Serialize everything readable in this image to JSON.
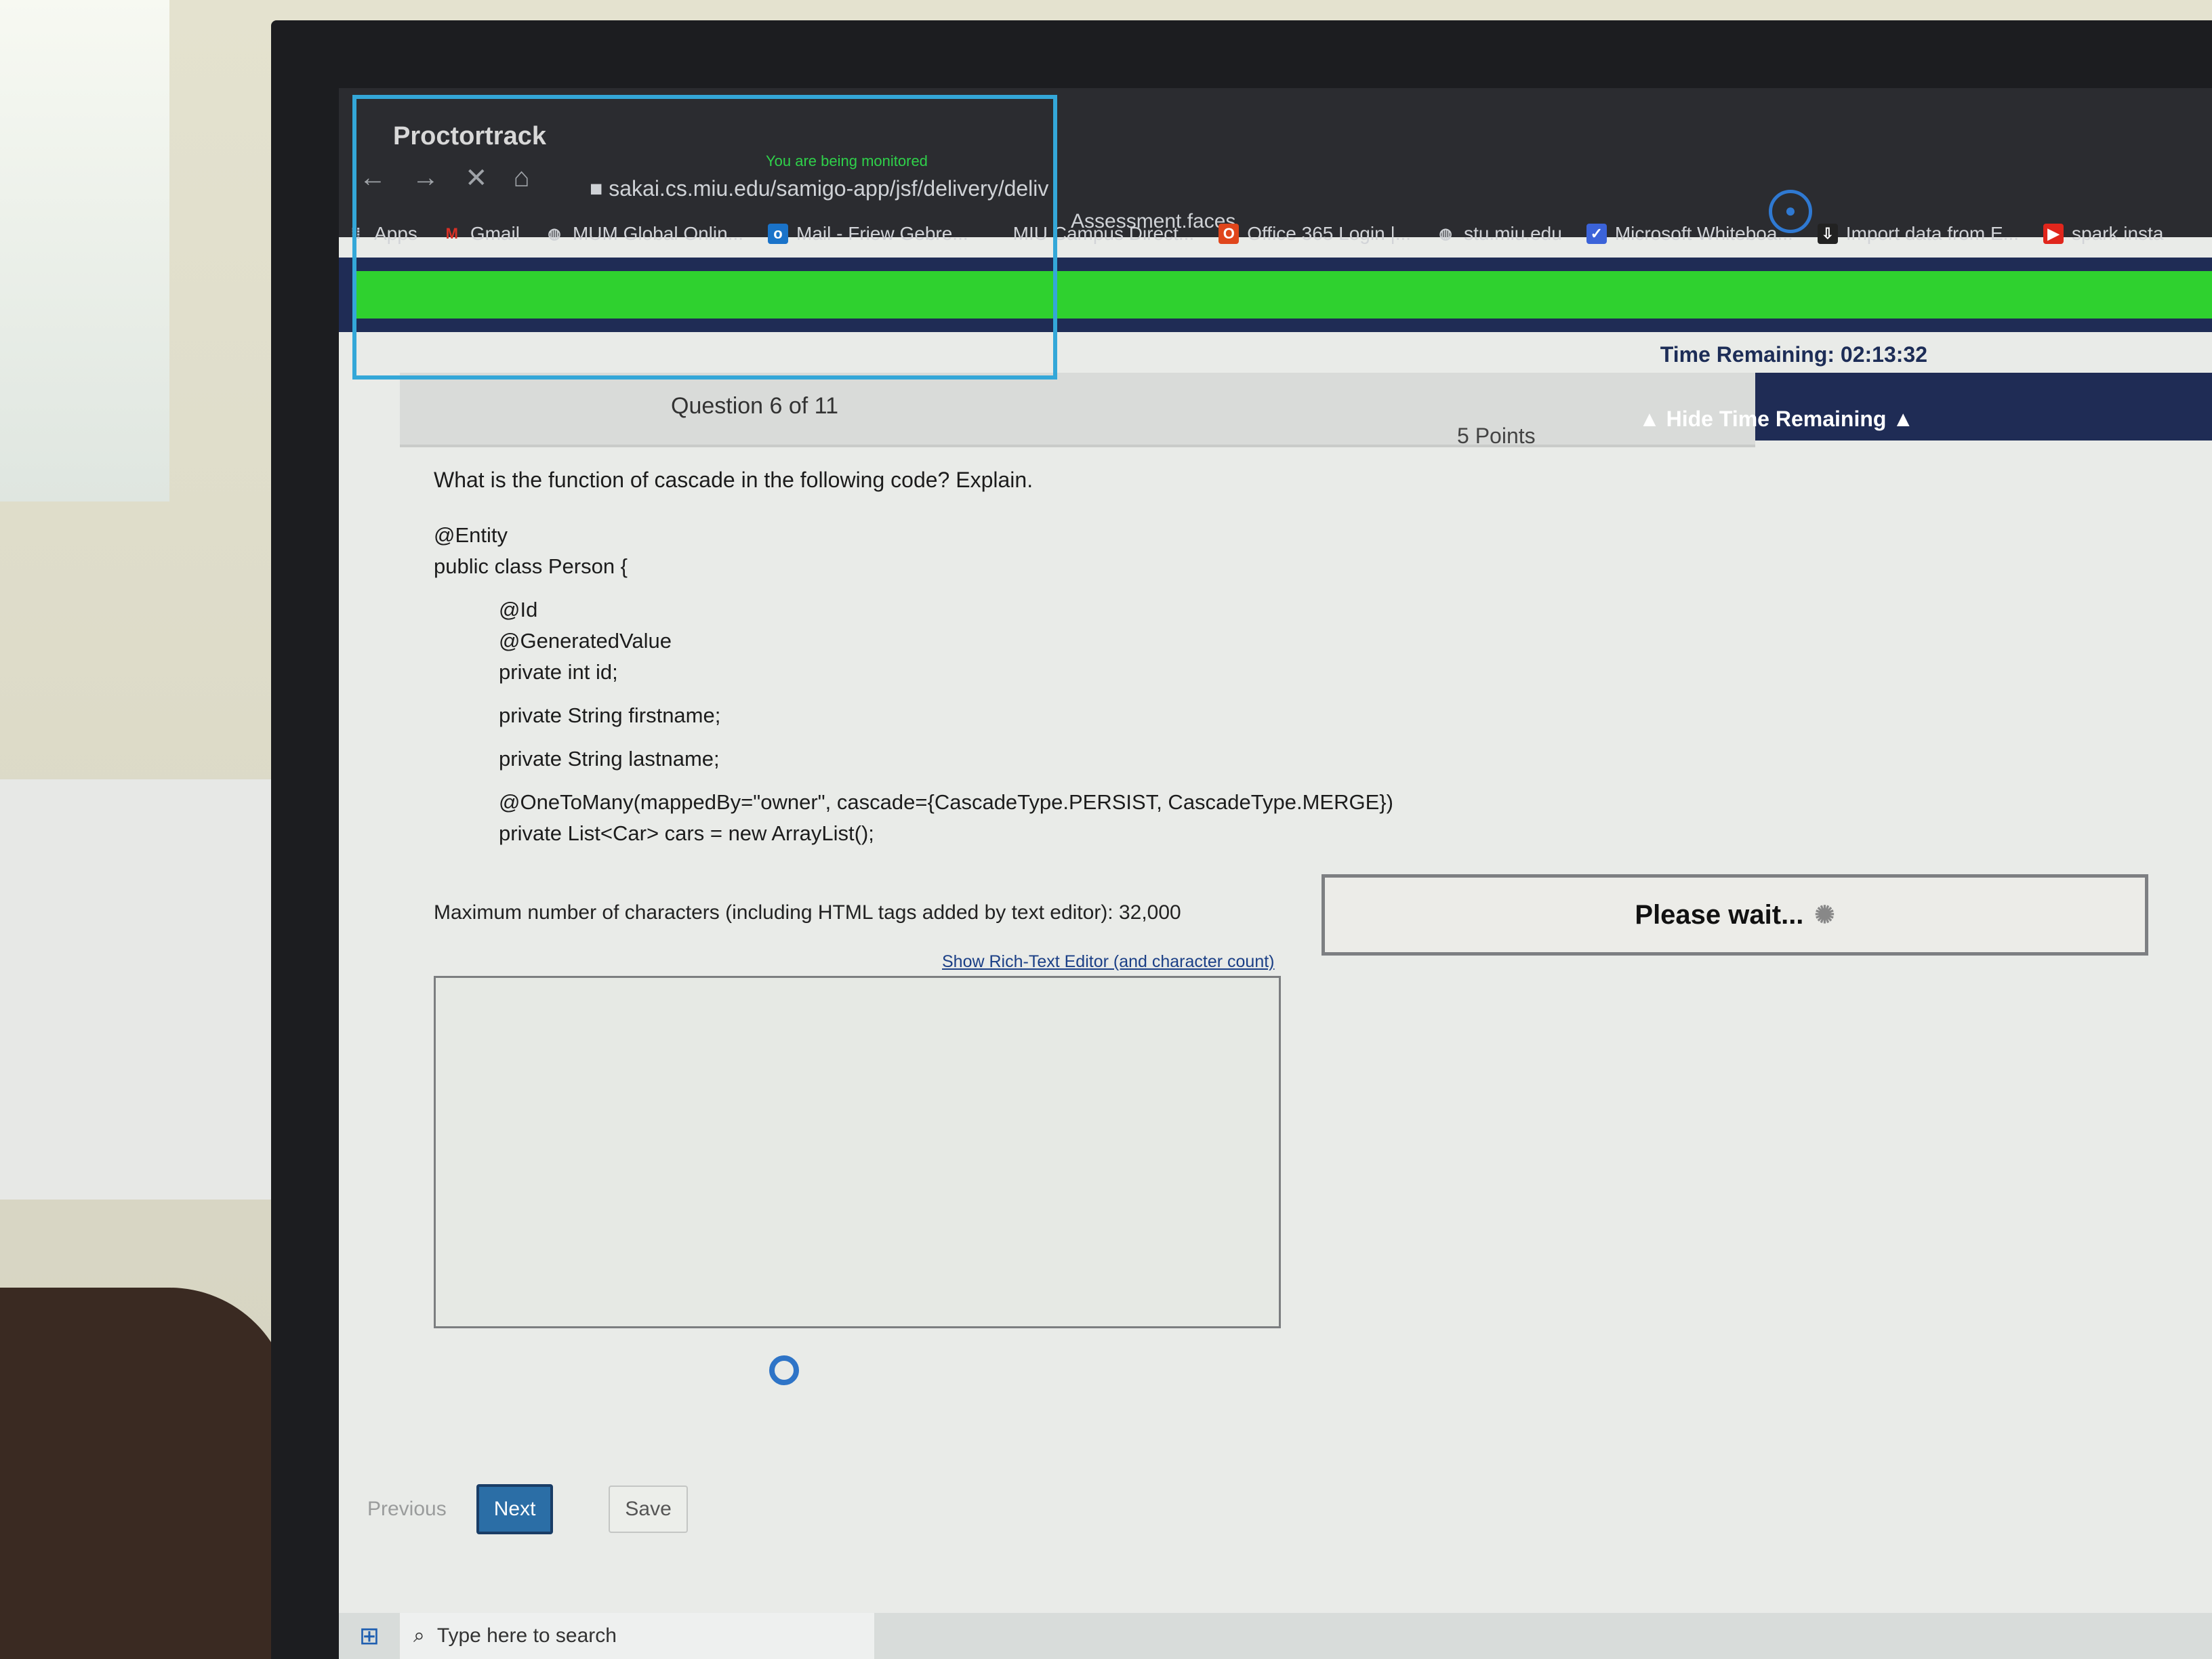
{
  "browser": {
    "app_title": "Proctortrack",
    "monitor_notice": "You are being monitored",
    "nav": {
      "back": "←",
      "forward": "→",
      "stop": "✕",
      "home": "⌂"
    },
    "url": "sakai.cs.miu.edu/samigo-app/jsf/delivery/deliv",
    "url_tail": "Assessment.faces",
    "record_icon": "record-icon"
  },
  "bookmarks": [
    {
      "label": "Apps",
      "icon": "apps-grid-icon",
      "color": "#b9c2d0"
    },
    {
      "label": "Gmail",
      "icon": "gmail-icon",
      "color": "#d93025"
    },
    {
      "label": "MUM Global Onlin...",
      "icon": "globe-icon",
      "color": "#cfd2d6"
    },
    {
      "label": "Mail - Friew Gebre...",
      "icon": "outlook-icon",
      "color": "#1a73c9"
    },
    {
      "label": "MIU Campus Direct...",
      "icon": "page-icon",
      "color": "#cfd2d6"
    },
    {
      "label": "Office 365 Login |...",
      "icon": "office-icon",
      "color": "#e0461c"
    },
    {
      "label": "stu.miu.edu",
      "icon": "globe-icon",
      "color": "#cfd2d6"
    },
    {
      "label": "Microsoft Whiteboa...",
      "icon": "whiteboard-icon",
      "color": "#3b63d9"
    },
    {
      "label": "Import data from E...",
      "icon": "import-icon",
      "color": "#222222"
    },
    {
      "label": "spark insta",
      "icon": "youtube-icon",
      "color": "#e0261c"
    }
  ],
  "timer": {
    "time_remaining": "Time Remaining: 02:13:32",
    "hide_label": "▲ Hide Time Remaining ▲"
  },
  "question": {
    "number": "Question 6 of 11",
    "points": "5 Points",
    "prompt": "What is the function of cascade in the following code? Explain.",
    "code_top": [
      "@Entity",
      "public class Person {"
    ],
    "code_block1": [
      "@Id",
      "@GeneratedValue",
      "private int id;"
    ],
    "code_line_firstname": "private String firstname;",
    "code_line_lastname": "private String lastname;",
    "code_block2": [
      "@OneToMany(mappedBy=\"owner\", cascade={CascadeType.PERSIST, CascadeType.MERGE})",
      "private List<Car> cars = new ArrayList();"
    ]
  },
  "answer": {
    "max_chars_note": "Maximum number of characters (including HTML tags added by text editor): 32,000",
    "rich_text_link": "Show Rich-Text Editor (and character count)",
    "value": ""
  },
  "status": {
    "please_wait": "Please wait...",
    "wait_icon": "loading-icon"
  },
  "buttons": {
    "previous": "Previous",
    "next": "Next",
    "save": "Save"
  },
  "taskbar": {
    "start_icon": "windows-start-icon",
    "search_placeholder": "Type here to search"
  },
  "colors": {
    "progress_green": "#2fd12f",
    "header_navy": "#1f2c55",
    "next_button": "#2b6ea6",
    "proctor_frame": "#34a7d8"
  }
}
